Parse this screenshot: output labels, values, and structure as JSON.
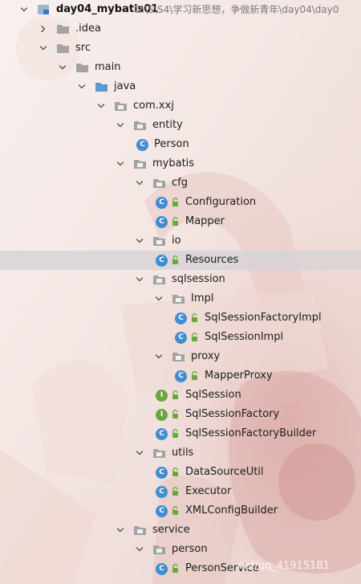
{
  "project": {
    "name": "day04_mybatis01",
    "path": "G:\\S\\S4\\学习新思想，争做新青年\\day04\\day0"
  },
  "tree": [
    {
      "label": "day04_mybatis01",
      "type": "project",
      "depth": 0,
      "expanded": true
    },
    {
      "label": ".idea",
      "type": "folder",
      "depth": 1,
      "expanded": false
    },
    {
      "label": "src",
      "type": "folder",
      "depth": 1,
      "expanded": true
    },
    {
      "label": "main",
      "type": "folder",
      "depth": 2,
      "expanded": true
    },
    {
      "label": "java",
      "type": "source-folder",
      "depth": 3,
      "expanded": true
    },
    {
      "label": "com.xxj",
      "type": "package",
      "depth": 4,
      "expanded": true
    },
    {
      "label": "entity",
      "type": "package",
      "depth": 5,
      "expanded": true
    },
    {
      "label": "Person",
      "type": "class",
      "depth": 6
    },
    {
      "label": "mybatis",
      "type": "package",
      "depth": 5,
      "expanded": true
    },
    {
      "label": "cfg",
      "type": "package",
      "depth": 6,
      "expanded": true
    },
    {
      "label": "Configuration",
      "type": "class",
      "depth": 7,
      "public": true
    },
    {
      "label": "Mapper",
      "type": "class",
      "depth": 7,
      "public": true
    },
    {
      "label": "io",
      "type": "package",
      "depth": 6,
      "expanded": true
    },
    {
      "label": "Resources",
      "type": "class",
      "depth": 7,
      "public": true,
      "selected": true
    },
    {
      "label": "sqlsession",
      "type": "package",
      "depth": 6,
      "expanded": true
    },
    {
      "label": "Impl",
      "type": "package",
      "depth": 7,
      "expanded": true
    },
    {
      "label": "SqlSessionFactoryImpl",
      "type": "class",
      "depth": 8,
      "public": true
    },
    {
      "label": "SqlSessionImpl",
      "type": "class",
      "depth": 8,
      "public": true
    },
    {
      "label": "proxy",
      "type": "package",
      "depth": 7,
      "expanded": true
    },
    {
      "label": "MapperProxy",
      "type": "class",
      "depth": 8,
      "public": true
    },
    {
      "label": "SqlSession",
      "type": "interface",
      "depth": 7,
      "public": true
    },
    {
      "label": "SqlSessionFactory",
      "type": "interface",
      "depth": 7,
      "public": true
    },
    {
      "label": "SqlSessionFactoryBuilder",
      "type": "class",
      "depth": 7,
      "public": true
    },
    {
      "label": "utils",
      "type": "package",
      "depth": 6,
      "expanded": true
    },
    {
      "label": "DataSourceUtil",
      "type": "class",
      "depth": 7,
      "public": true
    },
    {
      "label": "Executor",
      "type": "class",
      "depth": 7,
      "public": true
    },
    {
      "label": "XMLConfigBuilder",
      "type": "class",
      "depth": 7,
      "public": true
    },
    {
      "label": "service",
      "type": "package",
      "depth": 5,
      "expanded": true
    },
    {
      "label": "person",
      "type": "package",
      "depth": 6,
      "expanded": true
    },
    {
      "label": "PersonService",
      "type": "class",
      "depth": 7,
      "public": true
    }
  ],
  "watermark": "net/qq_41915181",
  "icons": {
    "expanded": "chevron-down-icon",
    "collapsed": "chevron-right-icon",
    "folder": "folder-icon",
    "source-folder": "source-folder-icon",
    "package": "package-icon",
    "class": "class-icon",
    "interface": "interface-icon",
    "public": "lock-icon",
    "project": "project-module-icon"
  },
  "colors": {
    "class_icon": "#3f8dd2",
    "interface_icon": "#6aa83f",
    "folder": "#a3a3a3",
    "source_folder": "#5b9bd5",
    "selection": "#d7d4d6",
    "lock": "#6aa83f"
  }
}
